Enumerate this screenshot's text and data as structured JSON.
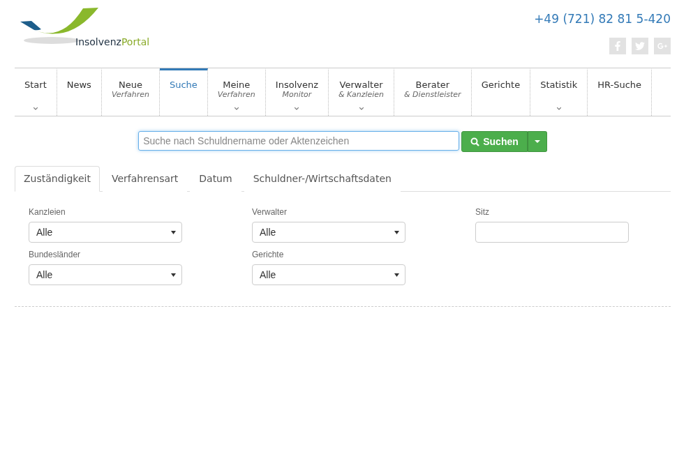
{
  "logo": {
    "text_1": "Insolvenz",
    "text_2": "Portal"
  },
  "phone": "+49 (721) 82 81 5-420",
  "nav": [
    {
      "label": "Start",
      "dropdown": true,
      "selected": false
    },
    {
      "label": "News",
      "dropdown": false,
      "selected": false
    },
    {
      "label": "Neue",
      "sub": "Verfahren",
      "dropdown": false,
      "selected": false
    },
    {
      "label": "Suche",
      "dropdown": false,
      "selected": true
    },
    {
      "label": "Meine",
      "sub": "Verfahren",
      "dropdown": true,
      "selected": false
    },
    {
      "label": "Insolvenz",
      "sub": "Monitor",
      "dropdown": true,
      "selected": false
    },
    {
      "label": "Verwalter",
      "sub": "& Kanzleien",
      "dropdown": true,
      "selected": false
    },
    {
      "label": "Berater",
      "sub": "& Dienstleister",
      "dropdown": false,
      "selected": false
    },
    {
      "label": "Gerichte",
      "dropdown": false,
      "selected": false
    },
    {
      "label": "Statistik",
      "dropdown": true,
      "selected": false
    },
    {
      "label": "HR-Suche",
      "dropdown": false,
      "selected": false
    }
  ],
  "search": {
    "placeholder": "Suche nach Schuldnername oder Aktenzeichen",
    "button": "Suchen"
  },
  "tabs": [
    {
      "label": "Zuständigkeit",
      "selected": true
    },
    {
      "label": "Verfahrensart",
      "selected": false
    },
    {
      "label": "Datum",
      "selected": false
    },
    {
      "label": "Schuldner-/Wirtschaftsdaten",
      "selected": false
    }
  ],
  "fields": [
    {
      "label": "Kanzleien",
      "kind": "select",
      "value": "Alle"
    },
    {
      "label": "Verwalter",
      "kind": "select",
      "value": "Alle"
    },
    {
      "label": "Sitz",
      "kind": "text"
    },
    {
      "label": "Bundesländer",
      "kind": "select",
      "value": "Alle"
    },
    {
      "label": "Gerichte",
      "kind": "select",
      "value": "Alle"
    }
  ]
}
